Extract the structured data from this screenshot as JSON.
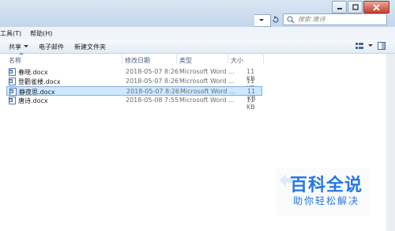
{
  "search": {
    "placeholder": "搜索 唐诗"
  },
  "menu": {
    "tools": "工具(T)",
    "help": "帮助(H)"
  },
  "toolbar": {
    "share": "共享",
    "email": "电子邮件",
    "new_folder": "新建文件夹"
  },
  "columns": {
    "name": "名称",
    "modified": "修改日期",
    "type": "类型",
    "size": "大小"
  },
  "files": [
    {
      "name": "春晓.docx",
      "modified": "2018-05-07  8:26",
      "type": "Microsoft Word ...",
      "size": "11 KB"
    },
    {
      "name": "登鹳雀楼.docx",
      "modified": "2018-05-07  8:26",
      "type": "Microsoft Word ...",
      "size": "11 KB"
    },
    {
      "name": "静夜思.docx",
      "modified": "2018-05-07  8:26",
      "type": "Microsoft Word ...",
      "size": "11 KB"
    },
    {
      "name": "唐诗.docx",
      "modified": "2018-05-08  7:55",
      "type": "Microsoft Word ...",
      "size": "11 KB"
    }
  ],
  "selected_index": 2,
  "watermark": {
    "title": "百科全说",
    "subtitle": "助你轻松解决"
  },
  "colors": {
    "accent": "#2577e3",
    "selection": "#cde8ff"
  }
}
